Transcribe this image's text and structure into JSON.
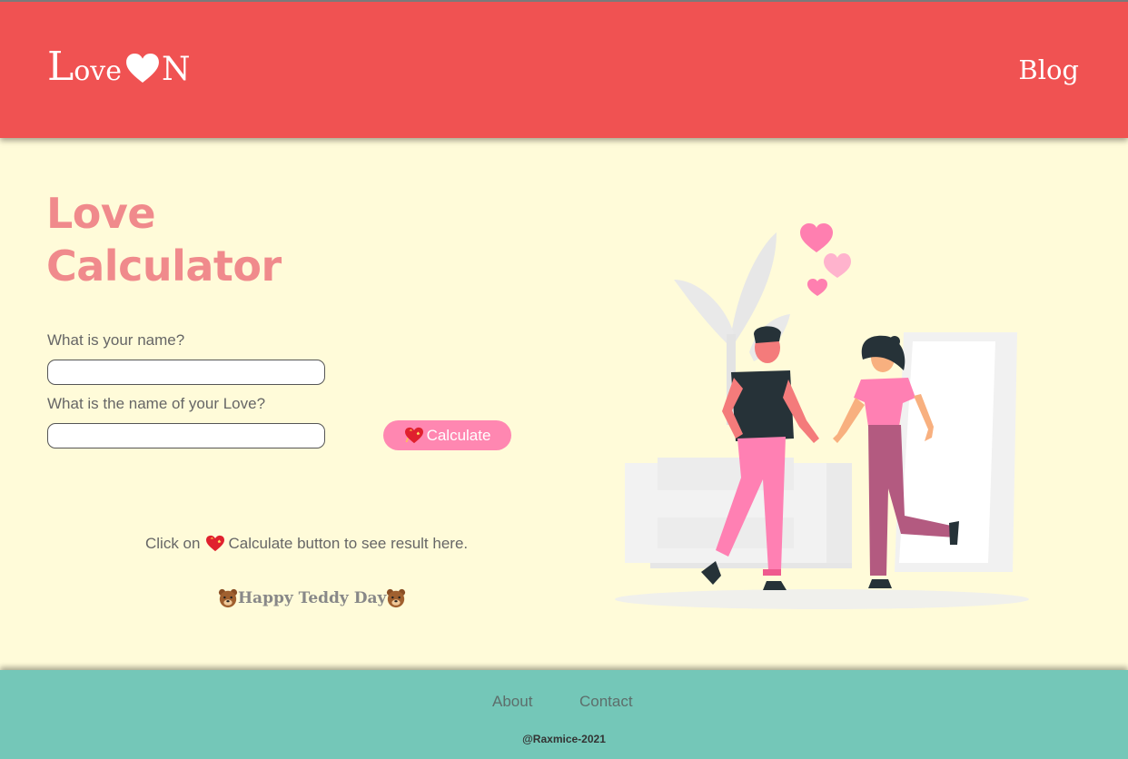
{
  "header": {
    "logo_text_L": "L",
    "logo_text_ove": "ove",
    "logo_text_N": "N",
    "logo_heart_icon": "heart-icon",
    "blog_link": "Blog"
  },
  "main": {
    "title_line1": "Love",
    "title_line2": "Calculator",
    "name_label": "What is your name?",
    "name_value": "",
    "love_label": "What is the name of your Love?",
    "love_value": "",
    "calculate_button": "Calculate",
    "calculate_icon": "sparkling-heart-icon",
    "result_prefix": "Click on",
    "result_suffix": "Calculate button to see result here.",
    "teddy_text": "Happy Teddy Day",
    "teddy_icon": "bear-face-icon"
  },
  "footer": {
    "about": "About",
    "contact": "Contact",
    "copyright": "@Raxmice-2021"
  },
  "colors": {
    "header": "#f05252",
    "background": "#fffbd9",
    "title": "#f08a8c",
    "button": "#ff87b1",
    "footer": "#74c7b8"
  }
}
